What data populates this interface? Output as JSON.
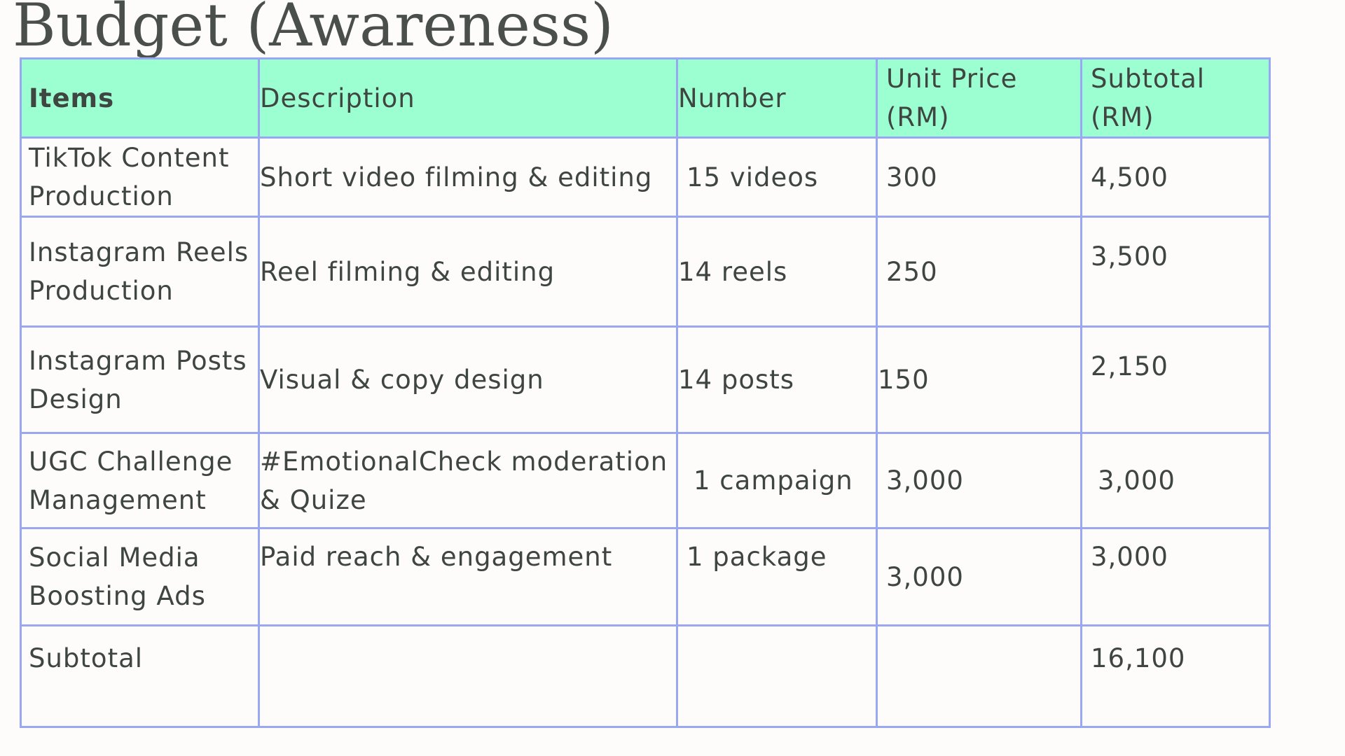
{
  "title": "Budget (Awareness)",
  "table": {
    "headers": [
      "Items",
      "Description",
      "Number",
      "Unit Price (RM)",
      "Subtotal (RM)"
    ],
    "rows": [
      {
        "item": "TikTok Content Production",
        "description": "Short video filming & editing",
        "number": "15 videos",
        "unit_price": "300",
        "subtotal": "4,500"
      },
      {
        "item": "Instagram Reels Production",
        "description": "Reel filming & editing",
        "number": "14 reels",
        "unit_price": "250",
        "subtotal": "3,500"
      },
      {
        "item": "Instagram Posts Design",
        "description": "Visual & copy design",
        "number": "14 posts",
        "unit_price": "150",
        "subtotal": "2,150"
      },
      {
        "item": "UGC Challenge Management",
        "description": "#EmotionalCheck moderation & Quize",
        "number": "1 campaign",
        "unit_price": "3,000",
        "subtotal": "3,000"
      },
      {
        "item": "Social Media Boosting Ads",
        "description": "Paid reach & engagement",
        "number": "1 package",
        "unit_price": "3,000",
        "subtotal": "3,000"
      }
    ],
    "total_row": {
      "label": "Subtotal",
      "description": "",
      "number": "",
      "unit_price": "",
      "subtotal": "16,100"
    }
  }
}
